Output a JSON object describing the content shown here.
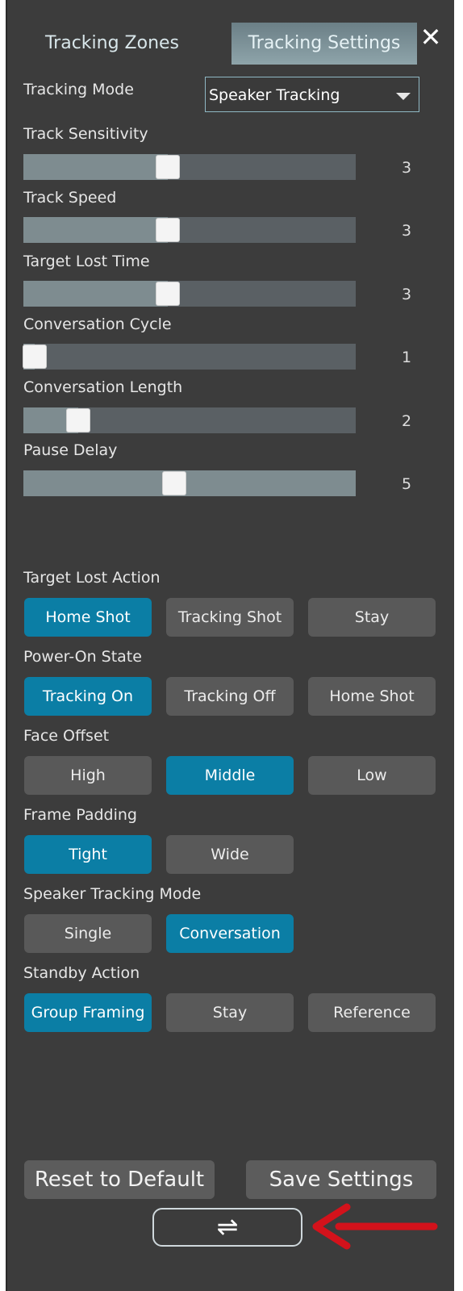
{
  "tabs": {
    "zones": "Tracking Zones",
    "settings": "Tracking Settings",
    "close": "✕"
  },
  "tracking_mode": {
    "label": "Tracking Mode",
    "value": "Speaker Tracking"
  },
  "sliders": [
    {
      "label": "Track Sensitivity",
      "value": "3",
      "level": 0.43
    },
    {
      "label": "Track Speed",
      "value": "3",
      "level": 0.43
    },
    {
      "label": "Target Lost Time",
      "value": "3",
      "level": 0.43
    },
    {
      "label": "Conversation Cycle",
      "value": "1",
      "level": 0.0
    },
    {
      "label": "Conversation Length",
      "value": "2",
      "level": 0.14
    },
    {
      "label": "Pause Delay",
      "value": "5",
      "level": 0.45
    }
  ],
  "groups": [
    {
      "label": "Target Lost Action",
      "options": [
        "Home Shot",
        "Tracking Shot",
        "Stay"
      ],
      "selected": 0
    },
    {
      "label": "Power-On State",
      "options": [
        "Tracking On",
        "Tracking Off",
        "Home Shot"
      ],
      "selected": 0
    },
    {
      "label": "Face Offset",
      "options": [
        "High",
        "Middle",
        "Low"
      ],
      "selected": 1
    },
    {
      "label": "Frame Padding",
      "options": [
        "Tight",
        "Wide"
      ],
      "selected": 0
    },
    {
      "label": "Speaker Tracking Mode",
      "options": [
        "Single",
        "Conversation"
      ],
      "selected": 1
    },
    {
      "label": "Standby Action",
      "options": [
        "Group Framing",
        "Stay",
        "Reference"
      ],
      "selected": 0
    }
  ],
  "footer": {
    "reset": "Reset to Default",
    "save": "Save Settings",
    "swap_icon": "⇌"
  },
  "colors": {
    "panel": "#3c3c3c",
    "accent": "#0b7ea5",
    "annotation_arrow": "#d3121b"
  }
}
